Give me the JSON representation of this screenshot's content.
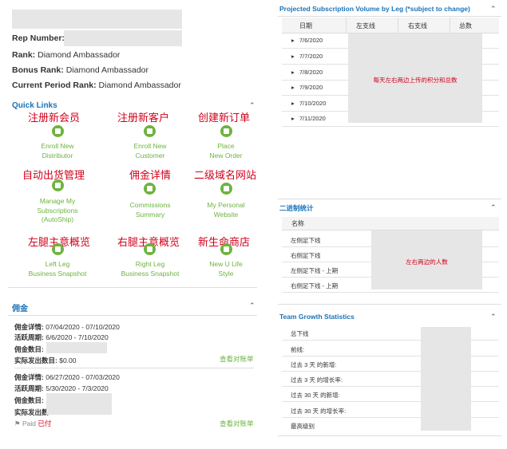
{
  "profile": {
    "rep_number_label": "Rep Number:",
    "rank_label": "Rank:",
    "rank_value": "Diamond Ambassador",
    "bonus_rank_label": "Bonus Rank:",
    "bonus_rank_value": "Diamond Ambassador",
    "current_rank_label": "Current Period Rank:",
    "current_rank_value": "Diamond Ambassador"
  },
  "quick_links": {
    "title": "Quick Links",
    "items": [
      {
        "annotation": "注册新会员",
        "line1": "Enroll New",
        "line2": "Distributor",
        "line3": "",
        "icon": "enroll-icon"
      },
      {
        "annotation": "注册新客户",
        "line1": "Enroll New",
        "line2": "Customer",
        "line3": "",
        "icon": "customer-icon"
      },
      {
        "annotation": "创建新订单",
        "line1": "Place",
        "line2": "New Order",
        "line3": "",
        "icon": "cart-icon"
      },
      {
        "annotation": "自动出货管理",
        "line1": "Manage My",
        "line2": "Subscriptions",
        "line3": "(AutoShip)",
        "icon": "subscription-icon"
      },
      {
        "annotation": "佣金详情",
        "line1": "Commissions",
        "line2": "Summary",
        "line3": "",
        "icon": "commission-icon"
      },
      {
        "annotation": "二级域名网站",
        "line1": "My Personal",
        "line2": "Website",
        "line3": "",
        "icon": "website-icon"
      },
      {
        "annotation": "左腿主意概览",
        "line1": "Left Leg",
        "line2": "Business Snapshot",
        "line3": "",
        "icon": "left-leg-icon"
      },
      {
        "annotation": "右腿主意概览",
        "line1": "Right Leg",
        "line2": "Business Snapshot",
        "line3": "",
        "icon": "right-leg-icon"
      },
      {
        "annotation": "新生命商店",
        "line1": "New U Life",
        "line2": "Style",
        "line3": "",
        "icon": "store-icon"
      }
    ]
  },
  "commission": {
    "title": "佣金",
    "blocks": [
      {
        "detail_label": "佣金详情:",
        "detail_value": "07/04/2020 - 07/10/2020",
        "active_label": "活跃周期:",
        "active_value": "6/6/2020 - 7/10/2020",
        "amount_label": "佣金数目:",
        "paid_label": "实际发出数目:",
        "paid_value": "$0.00",
        "link": "查看对账单",
        "status_en": "",
        "status_cn": ""
      },
      {
        "detail_label": "佣金详情:",
        "detail_value": "06/27/2020 - 07/03/2020",
        "active_label": "活跃周期:",
        "active_value": "5/30/2020 - 7/3/2020",
        "amount_label": "佣金数目:",
        "paid_label": "实际发出数",
        "paid_value": "",
        "link": "查看对账单",
        "status_en": "Paid",
        "status_cn": "已付"
      }
    ]
  },
  "projected": {
    "title": "Projected Subscription Volume by Leg (*subject to change)",
    "headers": [
      "日期",
      "左支线",
      "右支线",
      "总数"
    ],
    "dates": [
      "7/6/2020",
      "7/7/2020",
      "7/8/2020",
      "7/9/2020",
      "7/10/2020",
      "7/11/2020"
    ],
    "note": "每天左右两边上传的积分和总数"
  },
  "binary": {
    "title": "二进制统计",
    "header": "名称",
    "rows": [
      "左侧足下线",
      "右侧足下线",
      "左侧足下线 - 上期",
      "右侧足下线 - 上期"
    ],
    "note": "左右两边的人数"
  },
  "team": {
    "title": "Team Growth Statistics",
    "rows": [
      "总下线",
      "前线:",
      "过去 3 天 的新增:",
      "过去 3 天 的增长率:",
      "过去 30 天 的新增:",
      "过去 30 天 的增长率:",
      "最高级别"
    ]
  },
  "colors": {
    "accent_blue": "#1a73b8",
    "accent_green": "#6db33f",
    "annotation_red": "#d0021b"
  }
}
